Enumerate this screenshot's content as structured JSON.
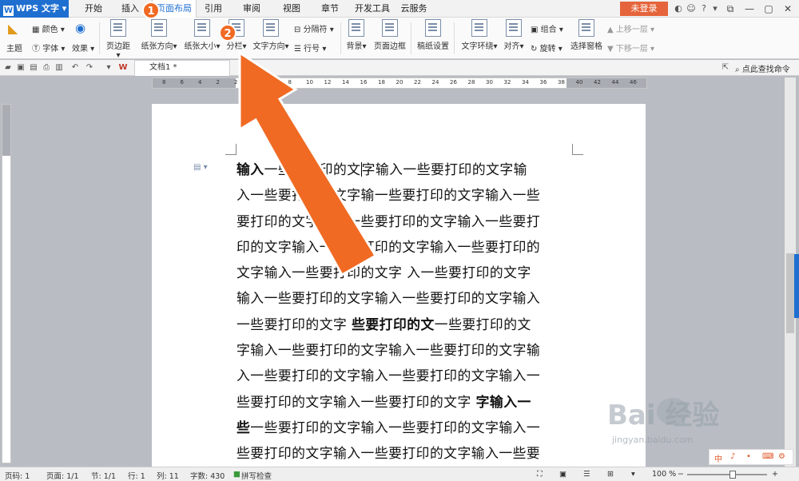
{
  "app": {
    "logo_text": "WPS 文字",
    "logo_glyph": "W",
    "accent_color": "#1f6fd0"
  },
  "menu_tabs": [
    "开始",
    "插入",
    "页面布局",
    "引用",
    "审阅",
    "视图",
    "章节",
    "开发工具",
    "云服务"
  ],
  "active_tab": "页面布局",
  "login_label": "未登录",
  "ribbon": {
    "theme": "主题",
    "color": "颜色",
    "font": "字体",
    "effect": "效果",
    "margin": "页边距",
    "orientation": "纸张方向",
    "paper_size": "纸张大小",
    "columns": "分栏",
    "text_direction": "文字方向",
    "separator": "分隔符",
    "line_number": "行号",
    "background": "背景",
    "page_border": "页面边框",
    "manuscript": "稿纸设置",
    "text_wrap": "文字环绕",
    "align": "对齐",
    "group": "组合",
    "rotate": "旋转",
    "select_pane": "选择窗格",
    "bring_forward": "上移一层",
    "send_backward": "下移一层"
  },
  "quickbar": {
    "doc_tab": "文档1 *",
    "search_command": "点此查找命令"
  },
  "ruler_ticks": [
    "8",
    "6",
    "4",
    "2",
    "2",
    "4",
    "6",
    "8",
    "10",
    "12",
    "14",
    "16",
    "18",
    "20",
    "22",
    "24",
    "26",
    "28",
    "30",
    "32",
    "34",
    "36",
    "38",
    "40",
    "42",
    "44",
    "46"
  ],
  "document": {
    "lines": [
      {
        "parts": [
          {
            "b": "输入"
          },
          {
            "t": "一些要打印的文"
          },
          {
            "caret": true
          },
          {
            "t": "字输入一些要打印的文字输"
          }
        ]
      },
      {
        "parts": [
          {
            "t": "入一些要打印的文字输一些要打印的文字输入一些"
          }
        ]
      },
      {
        "parts": [
          {
            "t": "要打印的文字输入一些要打印的文字输入一些要打"
          }
        ]
      },
      {
        "parts": [
          {
            "t": "印的文字输入一些要打印的文字输入一些要打印的"
          }
        ]
      },
      {
        "parts": [
          {
            "t": "文字输入一些要打印的文字 入一些要打印的文字"
          }
        ]
      },
      {
        "parts": [
          {
            "t": "输入一些要打印的文字输入一些要打印的文字输入"
          }
        ]
      },
      {
        "parts": [
          {
            "t": "一些要打印的文字 "
          },
          {
            "b": "些要打印的文"
          },
          {
            "t": "一些要打印的文"
          }
        ]
      },
      {
        "parts": [
          {
            "t": "字输入一些要打印的文字输入一些要打印的文字输"
          }
        ]
      },
      {
        "parts": [
          {
            "t": "入一些要打印的文字输入一些要打印的文字输入一"
          }
        ]
      },
      {
        "parts": [
          {
            "t": "些要打印的文字输入一些要打印的文字 "
          },
          {
            "b": "字输入一"
          }
        ]
      },
      {
        "parts": [
          {
            "b": "些"
          },
          {
            "t": "一些要打印的文字输入一些要打印的文字输入一"
          }
        ]
      },
      {
        "parts": [
          {
            "t": "些要打印的文字输入一些要打印的文字输入一些要"
          }
        ]
      }
    ]
  },
  "statusbar": {
    "page_code": "页码: 1",
    "page": "页面: 1/1",
    "section": "节: 1/1",
    "row": "行: 1",
    "col": "列: 11",
    "word_count": "字数: 430",
    "spell_check": "拼写检查",
    "zoom": "100 %"
  },
  "annotations": {
    "badge1": "1",
    "badge2": "2",
    "arrow_color": "#f06a23"
  },
  "watermark": {
    "brand": "Bai  经验",
    "url": "jingyan.baidu.com"
  },
  "minibar_glyphs": [
    "中",
    "♪",
    "•",
    "⌨",
    "⚙"
  ]
}
